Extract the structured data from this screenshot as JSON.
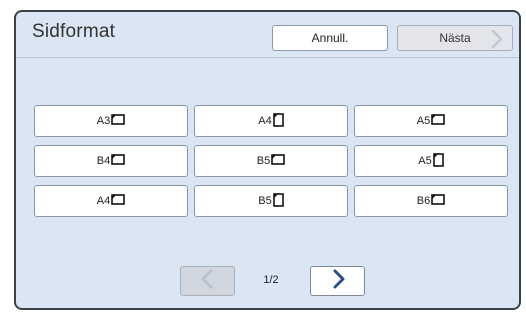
{
  "header": {
    "title": "Sidformat",
    "cancel_label": "Annull.",
    "next_label": "Nästa"
  },
  "sizes": [
    {
      "label": "A3",
      "orientation": "landscape"
    },
    {
      "label": "A4",
      "orientation": "portrait"
    },
    {
      "label": "A5",
      "orientation": "landscape"
    },
    {
      "label": "B4",
      "orientation": "landscape"
    },
    {
      "label": "B5",
      "orientation": "landscape"
    },
    {
      "label": "A5",
      "orientation": "portrait"
    },
    {
      "label": "A4",
      "orientation": "landscape"
    },
    {
      "label": "B5",
      "orientation": "portrait"
    },
    {
      "label": "B6",
      "orientation": "landscape"
    }
  ],
  "pager": {
    "label": "1/2",
    "prev_icon": "chevron-left-icon",
    "next_icon": "chevron-right-icon"
  },
  "colors": {
    "panel_bg": "#dbe6f4",
    "chevron_active": "#2a4f86",
    "chevron_disabled": "#b8c2d2"
  }
}
